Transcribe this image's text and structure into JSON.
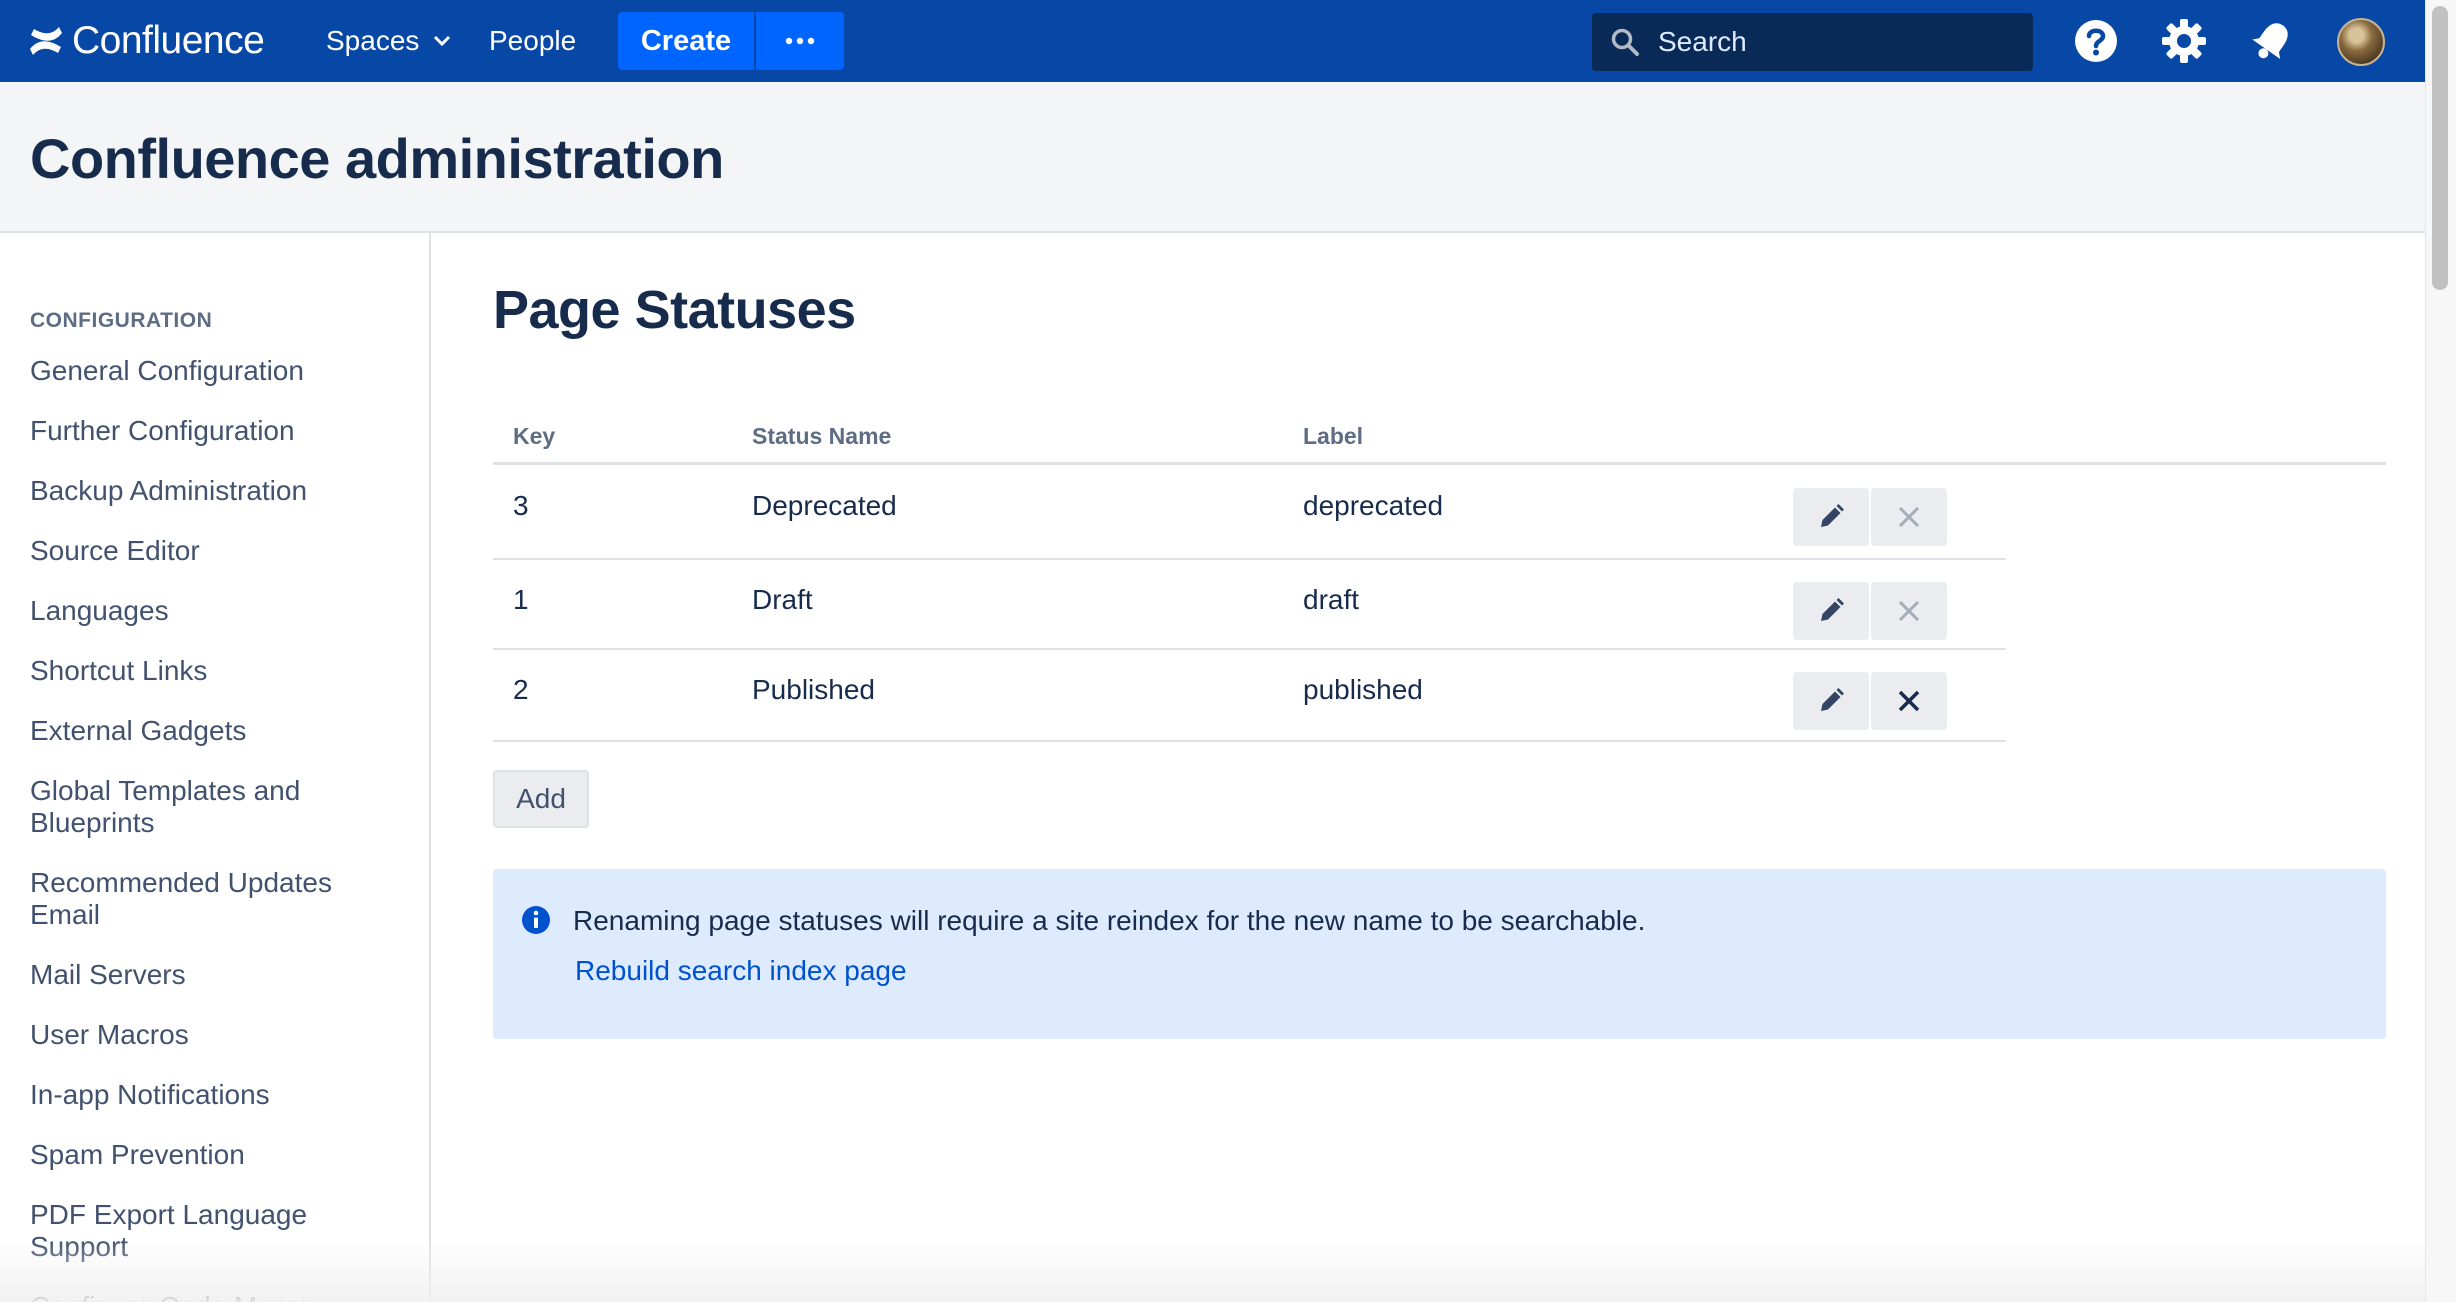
{
  "nav": {
    "brand": "Confluence",
    "spaces": "Spaces",
    "people": "People",
    "create": "Create",
    "more": "···",
    "search_placeholder": "Search",
    "icons": [
      "help-icon",
      "gear-icon",
      "notification-icon",
      "avatar"
    ]
  },
  "admin": {
    "title": "Confluence administration"
  },
  "sidebar": {
    "heading": "CONFIGURATION",
    "items": [
      "General Configuration",
      "Further Configuration",
      "Backup Administration",
      "Source Editor",
      "Languages",
      "Shortcut Links",
      "External Gadgets",
      "Global Templates and Blueprints",
      "Recommended Updates Email",
      "Mail Servers",
      "User Macros",
      "In-app Notifications",
      "Spam Prevention",
      "PDF Export Language Support",
      "Configure Code Macro"
    ]
  },
  "main": {
    "title": "Page Statuses",
    "columns": {
      "key": "Key",
      "status_name": "Status Name",
      "label": "Label"
    },
    "rows": [
      {
        "key": "3",
        "status_name": "Deprecated",
        "label": "deprecated",
        "delete_enabled": false
      },
      {
        "key": "1",
        "status_name": "Draft",
        "label": "draft",
        "delete_enabled": false
      },
      {
        "key": "2",
        "status_name": "Published",
        "label": "published",
        "delete_enabled": true
      }
    ],
    "add_label": "Add",
    "info": {
      "message": "Renaming page statuses will require a site reindex for the new name to be searchable.",
      "link": "Rebuild search index page"
    }
  },
  "colors": {
    "nav_bg": "#0747a6",
    "create_btn": "#0065ff",
    "info_bg": "#deebff",
    "link": "#0052cc"
  }
}
